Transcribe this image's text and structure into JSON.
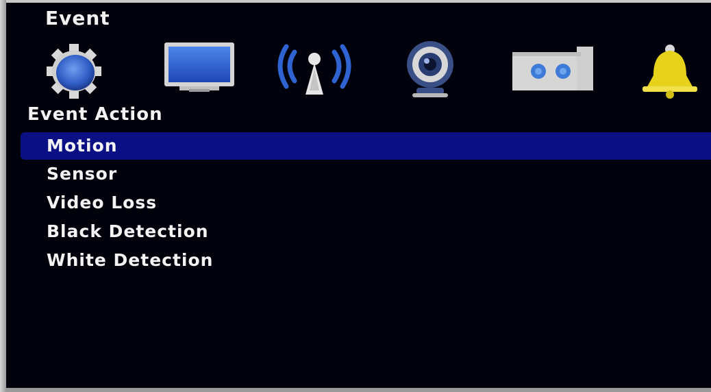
{
  "window": {
    "title": "Event"
  },
  "toolbar": {
    "icons": [
      {
        "name": "gear-icon",
        "color": "#3b6fd6"
      },
      {
        "name": "monitor-icon",
        "color": "#2f5fcf"
      },
      {
        "name": "wireless-icon",
        "color": "#2f63d2"
      },
      {
        "name": "camera-icon",
        "color": "#3a4f86"
      },
      {
        "name": "recorder-icon",
        "color": "#3e7bd8"
      },
      {
        "name": "bell-icon",
        "color": "#e6d21a"
      }
    ]
  },
  "section": {
    "heading": "Event Action"
  },
  "menu": {
    "items": [
      {
        "label": "Motion",
        "selected": true
      },
      {
        "label": "Sensor",
        "selected": false
      },
      {
        "label": "Video Loss",
        "selected": false
      },
      {
        "label": "Black Detection",
        "selected": false
      },
      {
        "label": "White Detection",
        "selected": false
      }
    ]
  },
  "colors": {
    "background": "#02020c",
    "selection": "#0b0f84",
    "text": "#f3f3f3"
  }
}
